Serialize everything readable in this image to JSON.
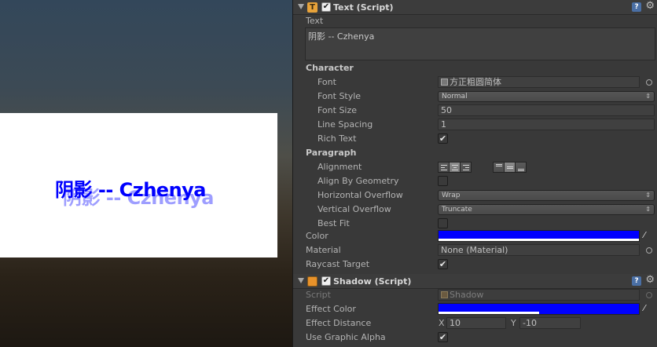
{
  "scene": {
    "preview_text": "阴影 -- Czhenya"
  },
  "text_component": {
    "title": "Text (Script)",
    "text_label": "Text",
    "text_value": "阴影 -- Czhenya",
    "character_section": "Character",
    "font_label": "Font",
    "font_value": "方正粗圆简体",
    "font_style_label": "Font Style",
    "font_style_value": "Normal",
    "font_size_label": "Font Size",
    "font_size_value": "50",
    "line_spacing_label": "Line Spacing",
    "line_spacing_value": "1",
    "rich_text_label": "Rich Text",
    "rich_text_checked": true,
    "paragraph_section": "Paragraph",
    "alignment_label": "Alignment",
    "alignment_horizontal": "center",
    "alignment_vertical": "middle",
    "align_by_geometry_label": "Align By Geometry",
    "align_by_geometry_checked": false,
    "horizontal_overflow_label": "Horizontal Overflow",
    "horizontal_overflow_value": "Wrap",
    "vertical_overflow_label": "Vertical Overflow",
    "vertical_overflow_value": "Truncate",
    "best_fit_label": "Best Fit",
    "best_fit_checked": false,
    "color_label": "Color",
    "color_value": "#0000ff",
    "material_label": "Material",
    "material_value": "None (Material)",
    "raycast_label": "Raycast Target",
    "raycast_checked": true
  },
  "shadow_component": {
    "title": "Shadow (Script)",
    "script_label": "Script",
    "script_value": "Shadow",
    "effect_color_label": "Effect Color",
    "effect_color_value": "#0000ff",
    "effect_color_alpha": 0.5,
    "effect_distance_label": "Effect Distance",
    "x_label": "X",
    "x_value": "10",
    "y_label": "Y",
    "y_value": "-10",
    "use_graphic_alpha_label": "Use Graphic Alpha",
    "use_graphic_alpha_checked": true
  },
  "icons": {
    "check": "✔",
    "help": "?",
    "gear": "⚙",
    "dropper": "⁄",
    "dropdown_arrows": "⇕"
  },
  "colors": {
    "accent_text_color": "#0000ff",
    "text_component_icon": "#e8a33a",
    "shadow_component_icon": "#e8922a"
  }
}
